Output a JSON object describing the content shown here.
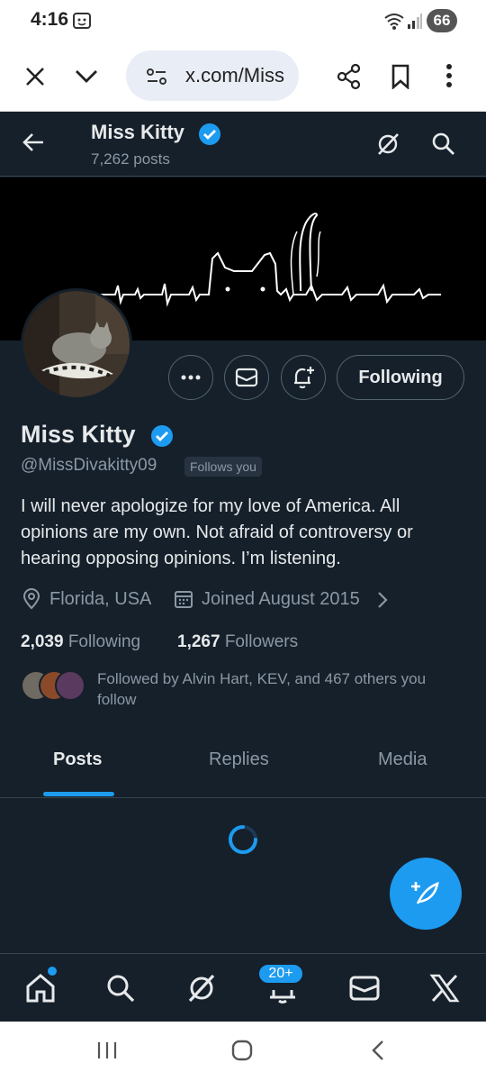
{
  "status_bar": {
    "time": "4:16",
    "battery": "66"
  },
  "browser": {
    "url": "x.com/Miss"
  },
  "header": {
    "name": "Miss Kitty",
    "posts_count": "7,262 posts"
  },
  "profile": {
    "name": "Miss Kitty",
    "handle": "@MissDivakitty09",
    "follows_you": "Follows you",
    "bio": "I will never apologize for my love of America. All opinions are my own. Not afraid of controversy or hearing opposing opinions. I’m listening.",
    "location": "Florida, USA",
    "joined": "Joined August 2015",
    "following_count": "2,039",
    "following_label": "Following",
    "followers_count": "1,267",
    "followers_label": "Followers",
    "followed_by": "Followed by Alvin Hart, KEV, and 467 others you follow",
    "follow_button": "Following"
  },
  "tabs": [
    "Posts",
    "Replies",
    "Media"
  ],
  "bottom_nav": {
    "notifications_badge": "20+"
  },
  "colors": {
    "accent": "#1d9bf0",
    "background": "#15202b",
    "text": "#e7e9ea",
    "muted": "#8b98a5"
  }
}
